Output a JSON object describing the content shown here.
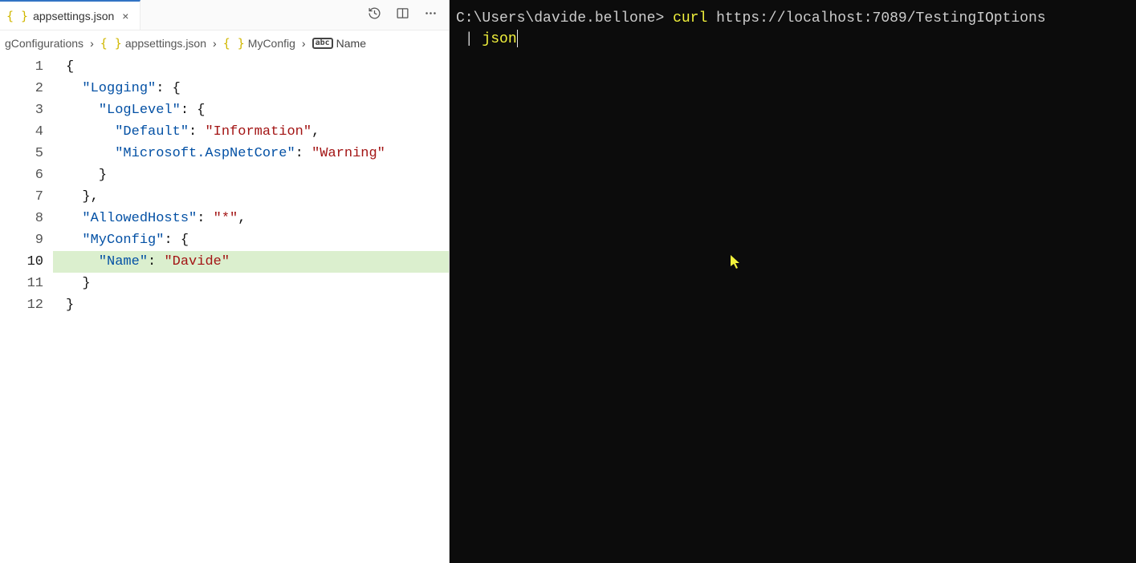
{
  "tab": {
    "file_name": "appsettings.json",
    "close_glyph": "×"
  },
  "breadcrumb": {
    "item1": "gConfigurations",
    "item2": "appsettings.json",
    "item3": "MyConfig",
    "item4": "Name",
    "sep": "›",
    "braces": "{ }"
  },
  "editor": {
    "highlighted_line": 10,
    "line_count": 12,
    "lines": {
      "l1": {
        "ln": "1",
        "indent": "",
        "tokens": [
          {
            "t": "{",
            "c": "tk-brace"
          }
        ]
      },
      "l2": {
        "ln": "2",
        "indent": "  ",
        "tokens": [
          {
            "t": "\"Logging\"",
            "c": "tk-key"
          },
          {
            "t": ": ",
            "c": "tk-colon"
          },
          {
            "t": "{",
            "c": "tk-brace"
          }
        ]
      },
      "l3": {
        "ln": "3",
        "indent": "    ",
        "tokens": [
          {
            "t": "\"LogLevel\"",
            "c": "tk-key"
          },
          {
            "t": ": ",
            "c": "tk-colon"
          },
          {
            "t": "{",
            "c": "tk-brace"
          }
        ]
      },
      "l4": {
        "ln": "4",
        "indent": "      ",
        "tokens": [
          {
            "t": "\"Default\"",
            "c": "tk-key"
          },
          {
            "t": ": ",
            "c": "tk-colon"
          },
          {
            "t": "\"Information\"",
            "c": "tk-str"
          },
          {
            "t": ",",
            "c": "tk-punc"
          }
        ]
      },
      "l5": {
        "ln": "5",
        "indent": "      ",
        "tokens": [
          {
            "t": "\"Microsoft.AspNetCore\"",
            "c": "tk-key"
          },
          {
            "t": ": ",
            "c": "tk-colon"
          },
          {
            "t": "\"Warning\"",
            "c": "tk-str"
          }
        ]
      },
      "l6": {
        "ln": "6",
        "indent": "    ",
        "tokens": [
          {
            "t": "}",
            "c": "tk-brace"
          }
        ]
      },
      "l7": {
        "ln": "7",
        "indent": "  ",
        "tokens": [
          {
            "t": "}",
            "c": "tk-brace"
          },
          {
            "t": ",",
            "c": "tk-punc"
          }
        ]
      },
      "l8": {
        "ln": "8",
        "indent": "  ",
        "tokens": [
          {
            "t": "\"AllowedHosts\"",
            "c": "tk-key"
          },
          {
            "t": ": ",
            "c": "tk-colon"
          },
          {
            "t": "\"*\"",
            "c": "tk-str"
          },
          {
            "t": ",",
            "c": "tk-punc"
          }
        ]
      },
      "l9": {
        "ln": "9",
        "indent": "  ",
        "tokens": [
          {
            "t": "\"MyConfig\"",
            "c": "tk-key"
          },
          {
            "t": ": ",
            "c": "tk-colon"
          },
          {
            "t": "{",
            "c": "tk-brace"
          }
        ]
      },
      "l10": {
        "ln": "10",
        "indent": "    ",
        "tokens": [
          {
            "t": "\"Name\"",
            "c": "tk-key"
          },
          {
            "t": ": ",
            "c": "tk-colon"
          },
          {
            "t": "\"Davide\"",
            "c": "tk-str"
          }
        ]
      },
      "l11": {
        "ln": "11",
        "indent": "  ",
        "tokens": [
          {
            "t": "}",
            "c": "tk-brace"
          }
        ]
      },
      "l12": {
        "ln": "12",
        "indent": "",
        "tokens": [
          {
            "t": "}",
            "c": "tk-brace"
          }
        ]
      }
    }
  },
  "terminal": {
    "prompt_path": "C:\\Users\\davide.bellone",
    "prompt_sep": "> ",
    "cmd1": "curl",
    "arg1": " https://localhost:7089/TestingIOptions",
    "cont_prefix": " | ",
    "cmd2": "json"
  }
}
